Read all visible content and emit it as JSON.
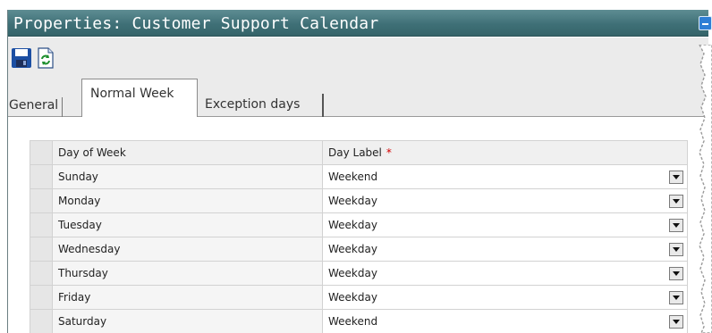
{
  "window": {
    "title": "Properties: Customer Support Calendar"
  },
  "toolbar": {
    "save_icon": "floppy-disk",
    "refresh_icon": "refresh-arrows"
  },
  "tabs": [
    {
      "label": "General"
    },
    {
      "label": "Normal Week"
    },
    {
      "label": "Exception days"
    }
  ],
  "table": {
    "headers": {
      "day": "Day of Week",
      "label": "Day Label",
      "required_mark": "*"
    },
    "rows": [
      {
        "day": "Sunday",
        "label": "Weekend"
      },
      {
        "day": "Monday",
        "label": "Weekday"
      },
      {
        "day": "Tuesday",
        "label": "Weekday"
      },
      {
        "day": "Wednesday",
        "label": "Weekday"
      },
      {
        "day": "Thursday",
        "label": "Weekday"
      },
      {
        "day": "Friday",
        "label": "Weekday"
      },
      {
        "day": "Saturday",
        "label": "Weekend"
      }
    ]
  },
  "colors": {
    "titlebar": "#3f7077",
    "toolbar": "#ebebeb",
    "required": "#d40000"
  }
}
